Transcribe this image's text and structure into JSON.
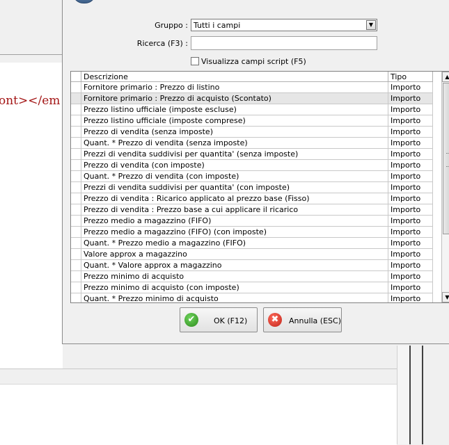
{
  "background": {
    "code_snippet_tag": "ont>",
    "code_snippet_rest": "</em"
  },
  "dialog": {
    "gruppo_label": "Gruppo :",
    "gruppo_value": "Tutti i campi",
    "ricerca_label": "Ricerca (F3) :",
    "ricerca_value": "",
    "checkbox_label": "Visualizza campi script (F5)",
    "checkbox_checked": false,
    "grid": {
      "columns": {
        "descrizione": "Descrizione",
        "tipo": "Tipo"
      },
      "rows": [
        {
          "desc": "Fornitore primario : Prezzo di listino",
          "tipo": "Importo"
        },
        {
          "desc": "Fornitore primario : Prezzo di acquisto (Scontato)",
          "tipo": "Importo"
        },
        {
          "desc": "Prezzo listino ufficiale (imposte escluse)",
          "tipo": "Importo"
        },
        {
          "desc": "Prezzo listino ufficiale (imposte comprese)",
          "tipo": "Importo"
        },
        {
          "desc": "Prezzo di vendita (senza imposte)",
          "tipo": "Importo"
        },
        {
          "desc": "Quant. * Prezzo di vendita (senza imposte)",
          "tipo": "Importo"
        },
        {
          "desc": "Prezzi di vendita suddivisi per quantita' (senza imposte)",
          "tipo": "Importo"
        },
        {
          "desc": "Prezzo di vendita (con imposte)",
          "tipo": "Importo"
        },
        {
          "desc": "Quant. * Prezzo di vendita (con imposte)",
          "tipo": "Importo"
        },
        {
          "desc": "Prezzi di vendita suddivisi per quantita' (con imposte)",
          "tipo": "Importo"
        },
        {
          "desc": "Prezzo di vendita : Ricarico applicato al prezzo base (Fisso)",
          "tipo": "Importo"
        },
        {
          "desc": "Prezzo di vendita : Prezzo base a cui applicare il ricarico",
          "tipo": "Importo"
        },
        {
          "desc": "Prezzo medio a magazzino (FIFO)",
          "tipo": "Importo"
        },
        {
          "desc": "Prezzo medio a magazzino (FIFO) (con imposte)",
          "tipo": "Importo"
        },
        {
          "desc": "Quant. * Prezzo medio a magazzino (FIFO)",
          "tipo": "Importo"
        },
        {
          "desc": "Valore approx a magazzino",
          "tipo": "Importo"
        },
        {
          "desc": "Quant. * Valore approx a magazzino",
          "tipo": "Importo"
        },
        {
          "desc": "Prezzo minimo di acquisto",
          "tipo": "Importo"
        },
        {
          "desc": "Prezzo minimo di acquisto (con imposte)",
          "tipo": "Importo"
        },
        {
          "desc": "Quant. * Prezzo minimo di acquisto",
          "tipo": "Importo"
        }
      ],
      "selected_row": 1
    },
    "ok_label": "OK (F12)",
    "cancel_label": "Annulla (ESC)"
  }
}
